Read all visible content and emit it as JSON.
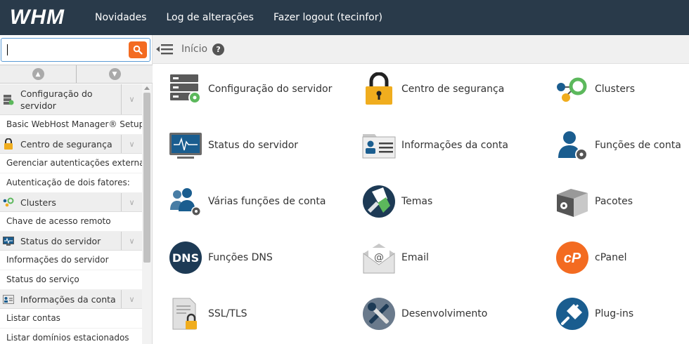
{
  "topbar": {
    "logo": "WHM",
    "links": [
      "Novidades",
      "Log de alterações",
      "Fazer logout (tecinfor)"
    ]
  },
  "search": {
    "value": "",
    "placeholder": ""
  },
  "breadcrumb": {
    "home": "Início",
    "help": "?"
  },
  "sidebar": {
    "sections": [
      {
        "title": "Configuração do servidor",
        "icon": "server-config-icon",
        "items": [
          "Basic WebHost Manager® Setup"
        ]
      },
      {
        "title": "Centro de segurança",
        "icon": "lock-icon",
        "items": [
          "Gerenciar autenticações externas",
          "Autenticação de dois fatores:"
        ]
      },
      {
        "title": "Clusters",
        "icon": "clusters-icon",
        "items": [
          "Chave de acesso remoto"
        ]
      },
      {
        "title": "Status do servidor",
        "icon": "monitor-icon",
        "items": [
          "Informações do servidor",
          "Status do serviço"
        ]
      },
      {
        "title": "Informações da conta",
        "icon": "id-card-icon",
        "items": [
          "Listar contas",
          "Listar domínios estacionados"
        ]
      }
    ]
  },
  "main": {
    "tiles": [
      {
        "label": "Configuração do servidor",
        "icon": "server-config-icon"
      },
      {
        "label": "Centro de segurança",
        "icon": "lock-icon"
      },
      {
        "label": "Clusters",
        "icon": "clusters-icon"
      },
      {
        "label": "Status do servidor",
        "icon": "monitor-icon"
      },
      {
        "label": "Informações da conta",
        "icon": "id-card-icon"
      },
      {
        "label": "Funções de conta",
        "icon": "user-gear-icon"
      },
      {
        "label": "Várias funções de conta",
        "icon": "users-gear-icon"
      },
      {
        "label": "Temas",
        "icon": "paint-brush-icon"
      },
      {
        "label": "Pacotes",
        "icon": "package-icon"
      },
      {
        "label": "Funções DNS",
        "icon": "dns-icon"
      },
      {
        "label": "Email",
        "icon": "email-icon"
      },
      {
        "label": "cPanel",
        "icon": "cpanel-icon"
      },
      {
        "label": "SSL/TLS",
        "icon": "ssl-certificate-icon"
      },
      {
        "label": "Desenvolvimento",
        "icon": "tools-icon"
      },
      {
        "label": "Plug-ins",
        "icon": "plug-icon"
      }
    ]
  },
  "colors": {
    "topbar": "#293a4a",
    "accent": "#f36b21",
    "link_blue": "#1a5d8f"
  }
}
